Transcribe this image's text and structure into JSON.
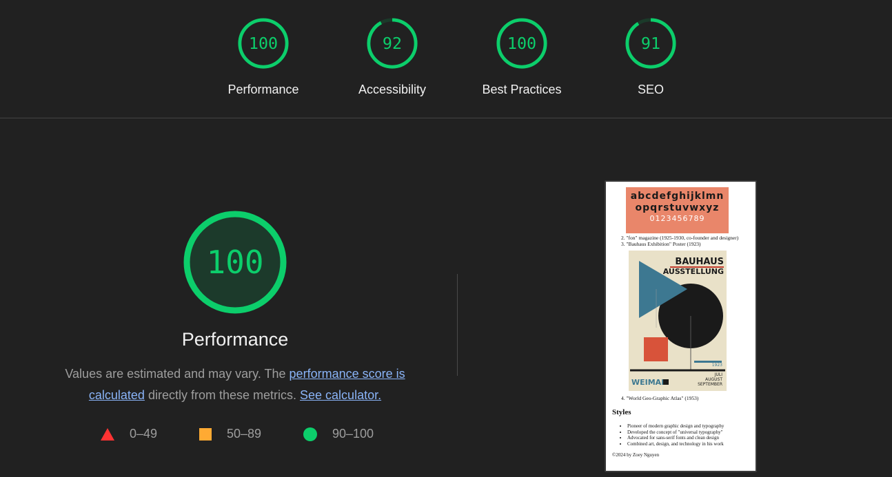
{
  "colors": {
    "pass": "#0cce6b",
    "average": "#ffaa33",
    "fail": "#ff3333",
    "link": "#8ab4f8"
  },
  "gauges": [
    {
      "score": "100",
      "label": "Performance"
    },
    {
      "score": "92",
      "label": "Accessibility"
    },
    {
      "score": "100",
      "label": "Best Practices"
    },
    {
      "score": "91",
      "label": "SEO"
    }
  ],
  "performance": {
    "score": "100",
    "title": "Performance",
    "desc_prefix": "Values are estimated and may vary. The ",
    "link_score": "performance score is calculated",
    "desc_middle": " directly from these metrics. ",
    "link_calc": "See calculator."
  },
  "legend": [
    {
      "icon": "fail-triangle-icon",
      "range": "0–49"
    },
    {
      "icon": "average-square-icon",
      "range": "50–89"
    },
    {
      "icon": "pass-circle-icon",
      "range": "90–100"
    }
  ],
  "screenshot": {
    "alphabet_line1": "abcdefghijklmn",
    "alphabet_line2": "opqrstuvwxyz",
    "alphabet_line3": "0123456789",
    "items_top": [
      "2. \"fon\" magazine (1925-1930, co-founder and designer)",
      "3. \"Bauhaus Exhibition\" Poster (1923)"
    ],
    "poster_title1": "BAUHAUS",
    "poster_title2": "AUSSTELLUNG",
    "poster_city": "WEIMAR",
    "poster_months": [
      "JULI",
      "AUGUST",
      "SEPTEMBER"
    ],
    "poster_year": "1923",
    "item4": "4. \"World Geo-Graphic Atlas\" (1953)",
    "styles_heading": "Styles",
    "bullets": [
      "Pioneer of modern graphic design and typography",
      "Developed the concept of \"universal typography\"",
      "Advocated for sans-serif fonts and clean design",
      "Combined art, design, and technology in his work"
    ],
    "footer": "©2024 by Zoey Nguyen"
  }
}
